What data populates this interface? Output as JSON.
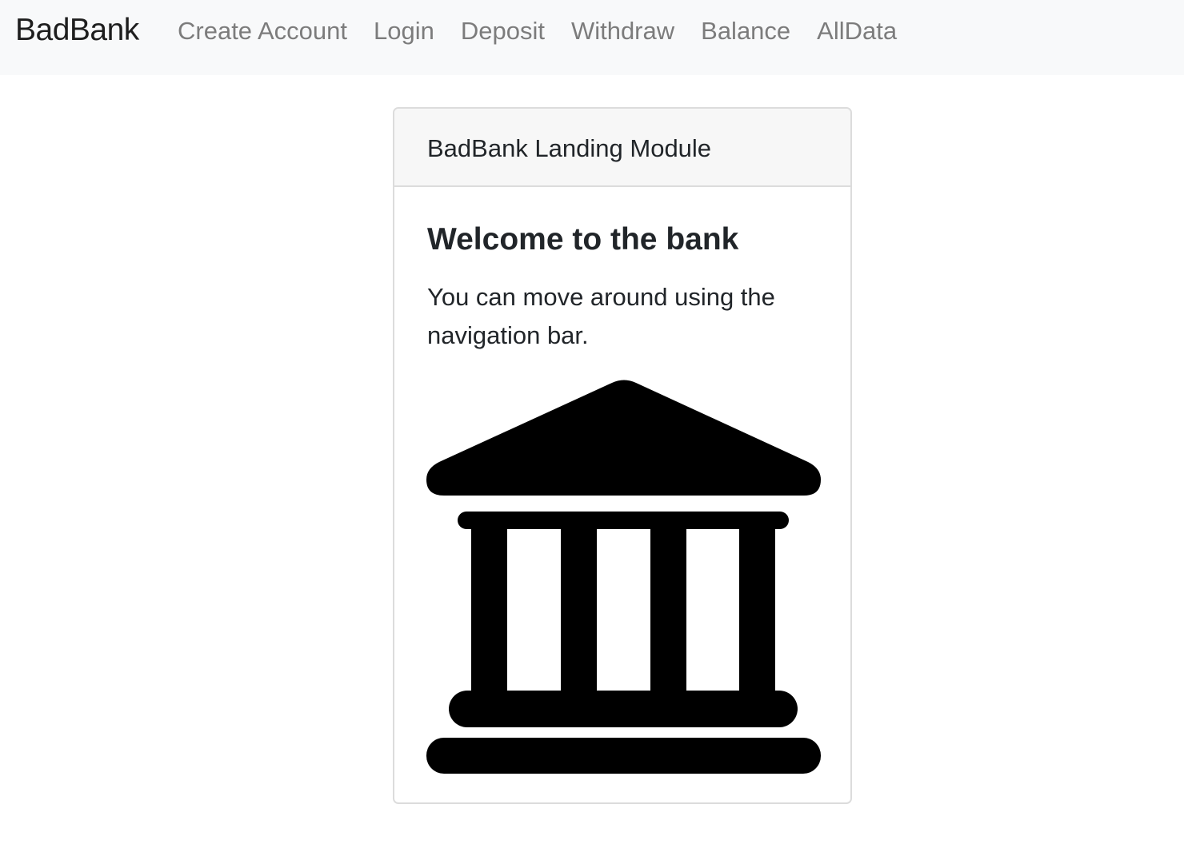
{
  "navbar": {
    "brand": "BadBank",
    "links": [
      {
        "label": "Create Account"
      },
      {
        "label": "Login"
      },
      {
        "label": "Deposit"
      },
      {
        "label": "Withdraw"
      },
      {
        "label": "Balance"
      },
      {
        "label": "AllData"
      }
    ]
  },
  "card": {
    "header": "BadBank Landing Module",
    "title": "Welcome to the bank",
    "text": "You can move around using the navigation bar.",
    "image_icon": "bank-icon"
  },
  "colors": {
    "navbar_bg": "#f8f9fa",
    "nav_link": "#7c7c7c",
    "card_header_bg": "#f7f7f7",
    "border": "#dcdcdc"
  }
}
